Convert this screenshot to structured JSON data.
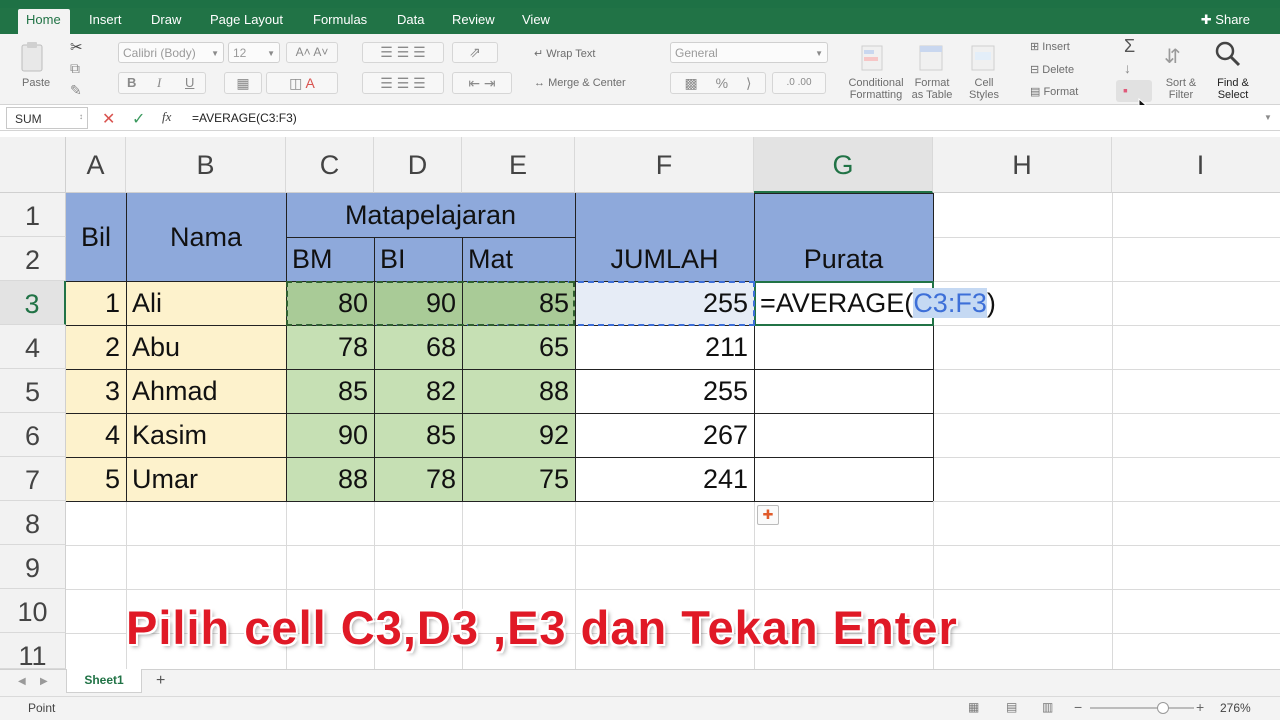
{
  "ribbon_tabs": [
    "Home",
    "Insert",
    "Draw",
    "Page Layout",
    "Formulas",
    "Data",
    "Review",
    "View"
  ],
  "share_label": "Share",
  "clipboard": {
    "paste": "Paste"
  },
  "font": {
    "name": "Calibri (Body)",
    "size": "12",
    "bold": "B",
    "italic": "I",
    "underline": "U"
  },
  "alignment": {
    "wrap": "Wrap Text",
    "merge": "Merge & Center"
  },
  "number": {
    "format": "General",
    "percent": "%"
  },
  "styles": {
    "conditional": [
      "Conditional",
      "Formatting"
    ],
    "format_table": [
      "Format",
      "as Table"
    ],
    "cell_styles": [
      "Cell",
      "Styles"
    ]
  },
  "cells_group": {
    "insert": "Insert",
    "delete": "Delete",
    "format": "Format"
  },
  "editing": {
    "sort": [
      "Sort &",
      "Filter"
    ],
    "find": [
      "Find &",
      "Select"
    ]
  },
  "formula_bar": {
    "name_box": "SUM",
    "formula": "=AVERAGE(C3:F3)",
    "fx": "fx"
  },
  "columns": [
    "A",
    "B",
    "C",
    "D",
    "E",
    "F",
    "G",
    "H",
    "I"
  ],
  "rows": [
    "1",
    "2",
    "3",
    "4",
    "5",
    "6",
    "7",
    "8",
    "9",
    "10",
    "11"
  ],
  "table": {
    "bil": "Bil",
    "nama": "Nama",
    "matapelajaran": "Matapelajaran",
    "bm": "BM",
    "bi": "BI",
    "mat": "Mat",
    "jumlah": "JUMLAH",
    "purata": "Purata",
    "data": [
      {
        "bil": "1",
        "nama": "Ali",
        "bm": "80",
        "bi": "90",
        "mat": "85",
        "jumlah": "255"
      },
      {
        "bil": "2",
        "nama": "Abu",
        "bm": "78",
        "bi": "68",
        "mat": "65",
        "jumlah": "211"
      },
      {
        "bil": "3",
        "nama": "Ahmad",
        "bm": "85",
        "bi": "82",
        "mat": "88",
        "jumlah": "255"
      },
      {
        "bil": "4",
        "nama": "Kasim",
        "bm": "90",
        "bi": "85",
        "mat": "92",
        "jumlah": "267"
      },
      {
        "bil": "5",
        "nama": "Umar",
        "bm": "88",
        "bi": "78",
        "mat": "75",
        "jumlah": "241"
      }
    ]
  },
  "edit_cell": {
    "prefix": "=AVERAGE(",
    "ref": "C3:F3",
    "suffix": ")"
  },
  "caption": "Pilih cell C3,D3 ,E3 dan Tekan Enter",
  "sheet_tab": "Sheet1",
  "add_sheet": "+",
  "status": {
    "mode": "Point",
    "zoom": "276%",
    "zoom_fraction": 0.7
  },
  "colors": {
    "excel_green": "#217346",
    "header_blue": "#8ea9db",
    "name_fill": "#fdf2cc",
    "score_fill": "#c6e0b4",
    "caption_red": "#e01926"
  }
}
